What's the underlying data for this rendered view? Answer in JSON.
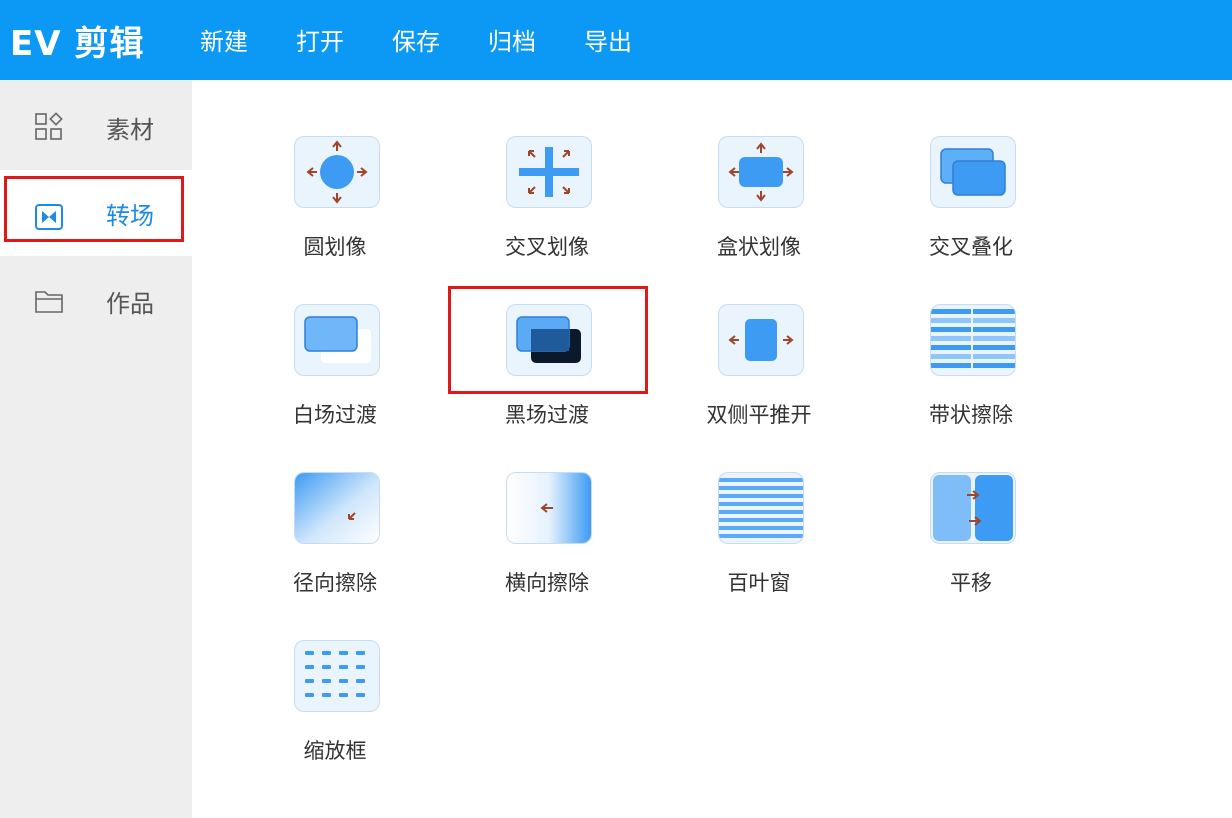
{
  "app_title": "EV 剪辑",
  "menu": [
    "新建",
    "打开",
    "保存",
    "归档",
    "导出"
  ],
  "sidebar": {
    "items": [
      {
        "label": "素材",
        "icon": "grid-shapes-icon"
      },
      {
        "label": "转场",
        "icon": "transition-icon",
        "active": true
      },
      {
        "label": "作品",
        "icon": "folder-icon"
      }
    ]
  },
  "transitions": [
    {
      "label": "圆划像",
      "icon": "circle-wipe-icon"
    },
    {
      "label": "交叉划像",
      "icon": "cross-wipe-icon"
    },
    {
      "label": "盒状划像",
      "icon": "box-wipe-icon"
    },
    {
      "label": "交叉叠化",
      "icon": "cross-dissolve-icon"
    },
    {
      "label": "白场过渡",
      "icon": "white-fade-icon"
    },
    {
      "label": "黑场过渡",
      "icon": "black-fade-icon",
      "highlighted": true
    },
    {
      "label": "双侧平推开",
      "icon": "double-push-icon"
    },
    {
      "label": "带状擦除",
      "icon": "band-wipe-icon"
    },
    {
      "label": "径向擦除",
      "icon": "radial-wipe-icon"
    },
    {
      "label": "横向擦除",
      "icon": "horizontal-wipe-icon"
    },
    {
      "label": "百叶窗",
      "icon": "blinds-icon"
    },
    {
      "label": "平移",
      "icon": "slide-icon"
    },
    {
      "label": "缩放框",
      "icon": "zoom-box-icon"
    }
  ],
  "colors": {
    "accent": "#0b99f5",
    "highlight": "#e01818",
    "icon_blue": "#3d9bf4"
  }
}
